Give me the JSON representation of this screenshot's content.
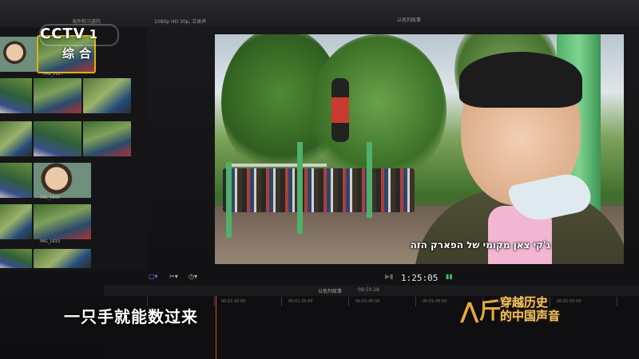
{
  "app": {
    "library_label": "海外和习进的",
    "format_label": "1080p HD 30p, 立体声",
    "viewer_title": "以色列故事",
    "timeline_title": "以色列故事",
    "timeline_duration": "08:50:28",
    "timecode": "1:25:05"
  },
  "browser": {
    "clips": [
      {
        "label": "IMG_1627"
      },
      {
        "label": "IMG_1632"
      },
      {
        "label": "IMG_1633"
      },
      {
        "label": "IMG_1635"
      }
    ]
  },
  "ruler": [
    "00:01:30:00",
    "00:01:35:00",
    "00:01:40:00",
    "00:01:45:00",
    "00:01:50:00",
    "00:01:55:00"
  ],
  "viewer": {
    "subtitle": "ג'קי צאן מקומי של הפארק הזה"
  },
  "broadcast": {
    "channel_logo": "CCTV",
    "channel_number": "1",
    "channel_sub": "综合",
    "caption": "一只手就能数过来",
    "program_line1": "穿越历史",
    "program_line2": "的中国声音",
    "accent_color": "#e3a93a"
  }
}
